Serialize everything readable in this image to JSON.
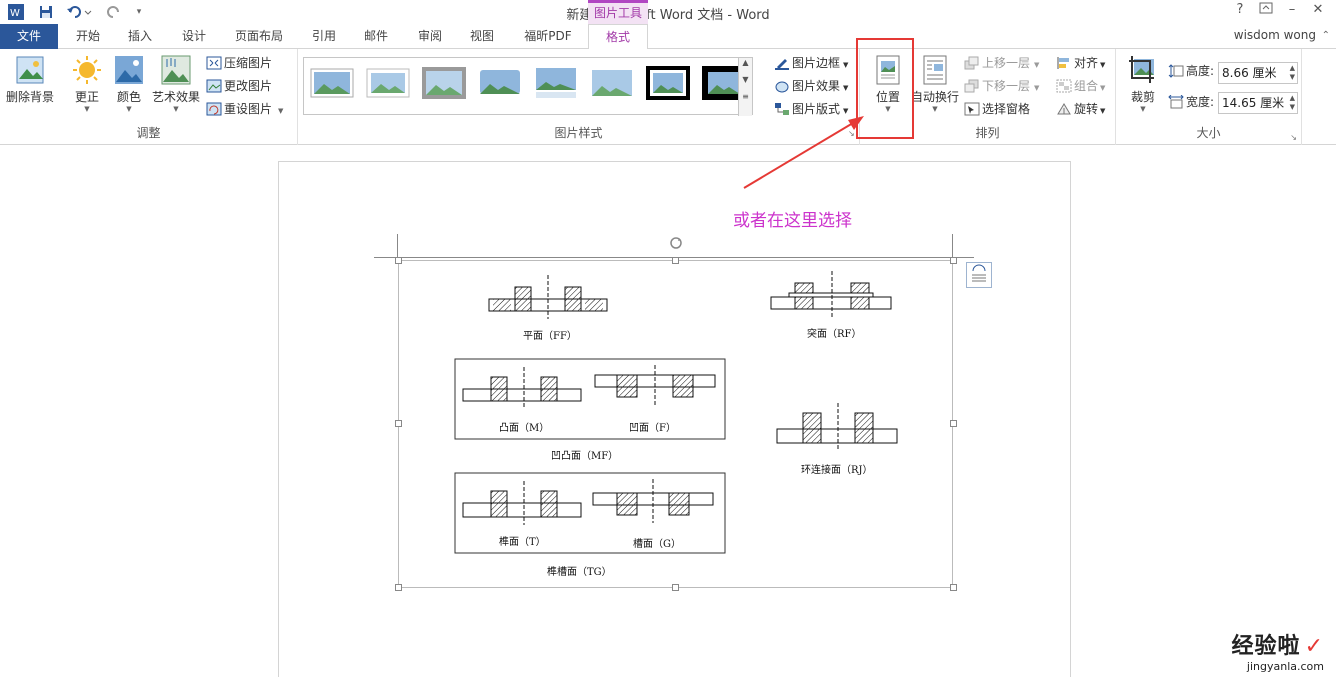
{
  "titlebar": {
    "title": "新建 Microsoft Word 文档 - Word",
    "context_tool": "图片工具",
    "help": "?",
    "minimize": "–",
    "close": "✕"
  },
  "tabs": {
    "file": "文件",
    "home": "开始",
    "insert": "插入",
    "design": "设计",
    "layout": "页面布局",
    "references": "引用",
    "mailings": "邮件",
    "review": "审阅",
    "view": "视图",
    "foxit": "福昕PDF",
    "format": "格式"
  },
  "user": "wisdom wong",
  "adjust": {
    "remove_bg": "删除背景",
    "corrections": "更正",
    "color": "颜色",
    "artistic": "艺术效果",
    "compress": "压缩图片",
    "change": "更改图片",
    "reset": "重设图片",
    "group_label": "调整"
  },
  "styles": {
    "border": "图片边框",
    "effects": "图片效果",
    "layout": "图片版式",
    "group_label": "图片样式"
  },
  "arrange": {
    "position": "位置",
    "wrap": "自动换行",
    "forward": "上移一层",
    "backward": "下移一层",
    "pane": "选择窗格",
    "align": "对齐",
    "group": "组合",
    "rotate": "旋转",
    "group_label": "排列"
  },
  "size": {
    "crop": "裁剪",
    "height_label": "高度:",
    "height_value": "8.66 厘米",
    "width_label": "宽度:",
    "width_value": "14.65 厘米",
    "group_label": "大小"
  },
  "annotation": "或者在这里选择",
  "figure": {
    "ff": "平面（FF）",
    "rf": "突面（RF）",
    "m": "凸面（M）",
    "f": "凹面（F）",
    "mf": "凹凸面（MF）",
    "rj": "环连接面（RJ）",
    "t": "榫面（T）",
    "g": "槽面（G）",
    "tg": "榫槽面（TG）"
  },
  "watermark": {
    "brand": "经验啦",
    "site": "jingyanla.com"
  },
  "colors": {
    "accent": "#2b579a",
    "context": "#a23aa8",
    "annotation": "#cc33cc",
    "highlight": "#e53935"
  }
}
